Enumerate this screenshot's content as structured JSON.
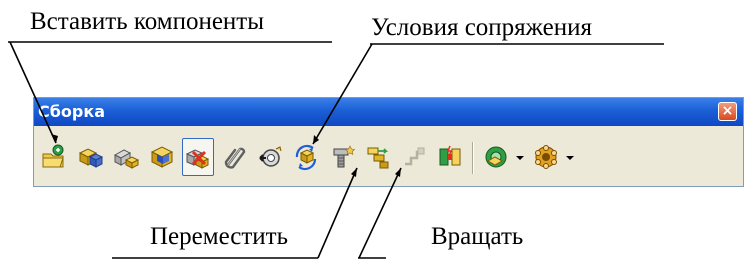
{
  "callouts": {
    "insert_components": "Вставить компоненты",
    "mate_conditions": "Условия сопряжения",
    "move": "Переместить",
    "rotate": "Вращать"
  },
  "toolbar": {
    "title": "Сборка",
    "close_glyph": "×",
    "tools": [
      {
        "icon": "insert-components-icon",
        "pressed": false
      },
      {
        "icon": "new-part-icon",
        "pressed": false
      },
      {
        "icon": "new-assembly-icon",
        "pressed": false
      },
      {
        "icon": "edit-component-icon",
        "pressed": false
      },
      {
        "icon": "hide-show-components-icon",
        "pressed": true
      },
      {
        "icon": "mate-conditions-icon",
        "pressed": false
      },
      {
        "icon": "move-component-icon",
        "pressed": false
      },
      {
        "icon": "rotate-component-icon",
        "pressed": false
      },
      {
        "icon": "smart-fasteners-icon",
        "pressed": false
      },
      {
        "icon": "explode-view-icon",
        "pressed": false
      },
      {
        "icon": "explode-line-sketch-icon",
        "pressed": false
      },
      {
        "icon": "interference-detection-icon",
        "pressed": false
      },
      {
        "icon": "assembly-features-icon",
        "pressed": false
      },
      {
        "icon": "pattern-component-icon",
        "pressed": false
      }
    ]
  },
  "colors": {
    "titlebar": "#1b5fd6",
    "toolbar_bg": "#ece9d8",
    "close_button": "#d84a1f"
  }
}
